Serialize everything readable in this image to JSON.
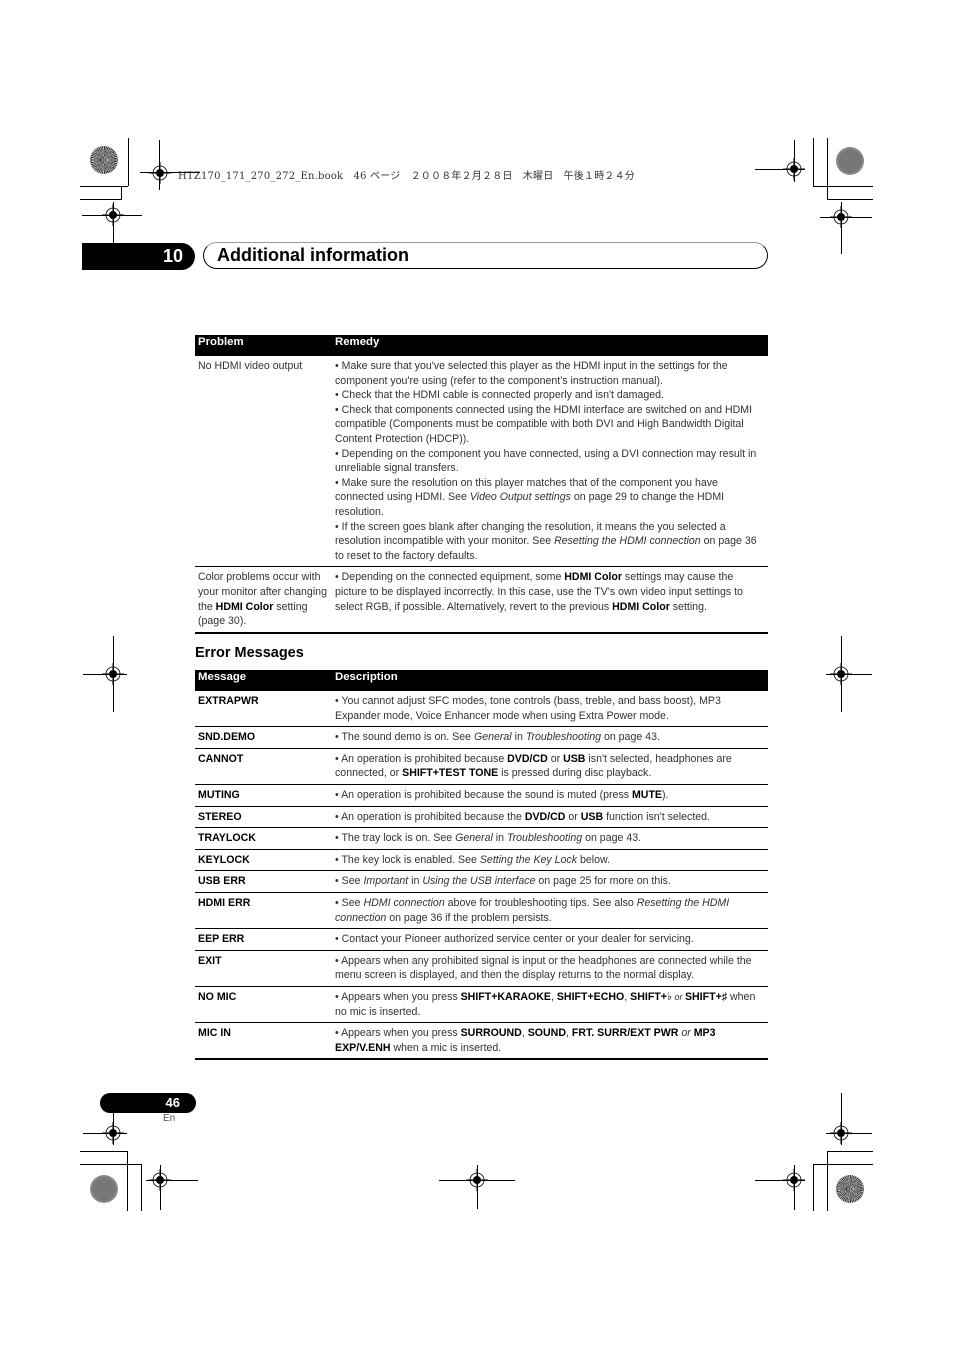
{
  "print_header": {
    "book_line": "HTZ170_171_270_272_En.book　46 ページ　２００８年２月２８日　木曜日　午後１時２４分"
  },
  "chapter": {
    "number": "10",
    "title": "Additional information"
  },
  "troubleshooting_table": {
    "columns": [
      "Problem",
      "Remedy"
    ],
    "rows": [
      {
        "problem": "No HDMI video output",
        "remedy_segments": [
          {
            "t": "• Make sure that you've selected this player as the HDMI input in the settings for the component you're using (refer to the component's instruction manual).",
            "s": "n",
            "br": true
          },
          {
            "t": "• Check that the HDMI cable is connected properly and isn't damaged.",
            "s": "n",
            "br": true
          },
          {
            "t": "• Check that components connected using the HDMI interface are switched on and HDMI compatible (Components must be compatible with both DVI and High Bandwidth Digital Content Protection (HDCP)).",
            "s": "n",
            "br": true
          },
          {
            "t": "• Depending on the component you have connected, using a DVI connection may result in unreliable signal transfers.",
            "s": "n",
            "br": true
          },
          {
            "t": "• Make sure the resolution on this player matches that of the component you have connected using HDMI. See ",
            "s": "n"
          },
          {
            "t": "Video Output settings",
            "s": "i"
          },
          {
            "t": " on page 29 to change the HDMI resolution.",
            "s": "n",
            "br": true
          },
          {
            "t": "• If the screen goes blank after changing the resolution, it means the you selected a resolution incompatible with your monitor. See ",
            "s": "n"
          },
          {
            "t": "Resetting the HDMI connection",
            "s": "i"
          },
          {
            "t": " on page 36 to reset to the factory defaults.",
            "s": "n"
          }
        ]
      },
      {
        "problem_segments": [
          {
            "t": "Color problems occur with your monitor after changing the ",
            "s": "n"
          },
          {
            "t": "HDMI Color",
            "s": "b"
          },
          {
            "t": " setting (page 30).",
            "s": "n"
          }
        ],
        "remedy_segments": [
          {
            "t": "• Depending on the connected equipment, some ",
            "s": "n"
          },
          {
            "t": "HDMI Color",
            "s": "b"
          },
          {
            "t": " settings may cause the picture to be displayed incorrectly. In this case, use the TV's own video input settings to select RGB, if possible. Alternatively, revert to the previous ",
            "s": "n"
          },
          {
            "t": "HDMI Color",
            "s": "b"
          },
          {
            "t": " setting.",
            "s": "n"
          }
        ]
      }
    ]
  },
  "error_section": {
    "heading": "Error Messages",
    "columns": [
      "Message",
      "Description"
    ],
    "rows": [
      {
        "message": "EXTRAPWR",
        "desc": [
          {
            "t": "• You cannot adjust SFC modes, tone controls (bass, treble, and bass boost), MP3 Expander mode, Voice Enhancer mode when using Extra Power mode.",
            "s": "n"
          }
        ]
      },
      {
        "message": "SND.DEMO",
        "desc": [
          {
            "t": "• The sound demo is on. See ",
            "s": "n"
          },
          {
            "t": "General",
            "s": "i"
          },
          {
            "t": " in ",
            "s": "n"
          },
          {
            "t": "Troubleshooting",
            "s": "i"
          },
          {
            "t": " on page 43.",
            "s": "n"
          }
        ]
      },
      {
        "message": "CANNOT",
        "desc": [
          {
            "t": "• An operation is prohibited because ",
            "s": "n"
          },
          {
            "t": "DVD/CD",
            "s": "b"
          },
          {
            "t": " or ",
            "s": "n"
          },
          {
            "t": "USB",
            "s": "b"
          },
          {
            "t": " isn't selected, headphones are connected, or ",
            "s": "n"
          },
          {
            "t": "SHIFT+TEST TONE",
            "s": "b"
          },
          {
            "t": " is pressed during disc playback.",
            "s": "n"
          }
        ]
      },
      {
        "message": "MUTING",
        "desc": [
          {
            "t": "• An operation is prohibited because the sound is muted (press ",
            "s": "n"
          },
          {
            "t": "MUTE",
            "s": "b"
          },
          {
            "t": ").",
            "s": "n"
          }
        ]
      },
      {
        "message": "STEREO",
        "desc": [
          {
            "t": "• An operation is prohibited because the ",
            "s": "n"
          },
          {
            "t": "DVD/CD",
            "s": "b"
          },
          {
            "t": " or ",
            "s": "n"
          },
          {
            "t": "USB",
            "s": "b"
          },
          {
            "t": " function isn't selected.",
            "s": "n"
          }
        ]
      },
      {
        "message": "TRAYLOCK",
        "desc": [
          {
            "t": "• The tray lock is on. See ",
            "s": "n"
          },
          {
            "t": "General",
            "s": "i"
          },
          {
            "t": " in ",
            "s": "n"
          },
          {
            "t": "Troubleshooting",
            "s": "i"
          },
          {
            "t": " on page 43.",
            "s": "n"
          }
        ]
      },
      {
        "message": "KEYLOCK",
        "desc": [
          {
            "t": "• The key lock is enabled. See ",
            "s": "n"
          },
          {
            "t": "Setting the Key Lock",
            "s": "i"
          },
          {
            "t": " below.",
            "s": "n"
          }
        ]
      },
      {
        "message": "USB ERR",
        "desc": [
          {
            "t": "• See ",
            "s": "n"
          },
          {
            "t": "Important",
            "s": "i"
          },
          {
            "t": " in ",
            "s": "n"
          },
          {
            "t": "Using the USB interface",
            "s": "i"
          },
          {
            "t": " on page 25 for more on this.",
            "s": "n"
          }
        ]
      },
      {
        "message": "HDMI ERR",
        "desc": [
          {
            "t": "• See ",
            "s": "n"
          },
          {
            "t": "HDMI connection",
            "s": "i"
          },
          {
            "t": " above for troubleshooting tips. See also ",
            "s": "n"
          },
          {
            "t": "Resetting the HDMI connection",
            "s": "i"
          },
          {
            "t": " on page 36 if the problem persists.",
            "s": "n"
          }
        ]
      },
      {
        "message": "EEP ERR",
        "desc": [
          {
            "t": "• Contact your Pioneer authorized service center or your dealer for servicing.",
            "s": "n"
          }
        ]
      },
      {
        "message": "EXIT",
        "desc": [
          {
            "t": "• Appears when any prohibited signal is input or the headphones are connected while the menu screen is displayed, and then the display returns to the normal display.",
            "s": "n"
          }
        ]
      },
      {
        "message": "NO MIC",
        "desc": [
          {
            "t": "• Appears when you press ",
            "s": "n"
          },
          {
            "t": "SHIFT+KARAOKE",
            "s": "b"
          },
          {
            "t": ", ",
            "s": "n"
          },
          {
            "t": "SHIFT+ECHO",
            "s": "b"
          },
          {
            "t": ", ",
            "s": "n"
          },
          {
            "t": "SHIFT+♭",
            "s": "b"
          },
          {
            "t": " or ",
            "s": "sm"
          },
          {
            "t": "SHIFT+♯",
            "s": "b"
          },
          {
            "t": " when no mic is inserted.",
            "s": "n"
          }
        ]
      },
      {
        "message": "MIC IN",
        "desc": [
          {
            "t": "• Appears when you press ",
            "s": "n"
          },
          {
            "t": "SURROUND",
            "s": "b"
          },
          {
            "t": ", ",
            "s": "n"
          },
          {
            "t": "SOUND",
            "s": "b"
          },
          {
            "t": ", ",
            "s": "n"
          },
          {
            "t": "FRT. SURR/EXT PWR",
            "s": "b"
          },
          {
            "t": " or ",
            "s": "i"
          },
          {
            "t": "MP3 EXP/V.ENH",
            "s": "b"
          },
          {
            "t": " when a mic is inserted.",
            "s": "n"
          }
        ]
      }
    ]
  },
  "footer": {
    "page_number": "46",
    "language": "En"
  }
}
